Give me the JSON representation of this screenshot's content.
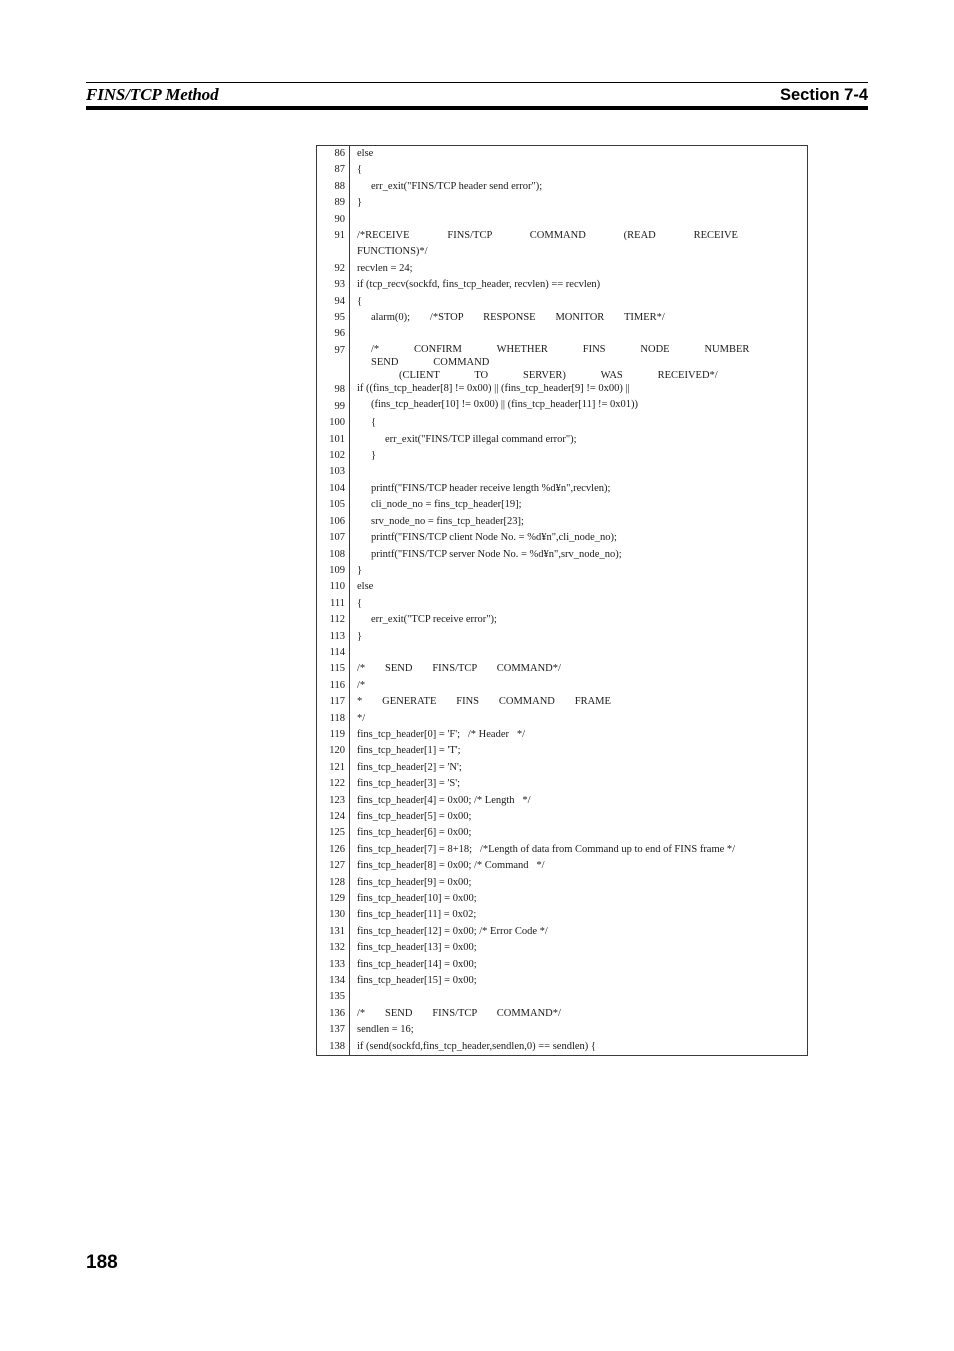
{
  "header": {
    "title": "FINS/TCP Method",
    "section": "Section 7-4"
  },
  "folio": {
    "page_number": "188"
  },
  "colors": {
    "text": "#000000",
    "rule": "#3a3a3a",
    "background": "#ffffff"
  },
  "listing": {
    "lines": [
      {
        "n": "86",
        "indent": 1,
        "text": "else"
      },
      {
        "n": "87",
        "indent": 1,
        "text": "{"
      },
      {
        "n": "88",
        "indent": 2,
        "text": "err_exit(\"FINS/TCP header send error\");"
      },
      {
        "n": "89",
        "indent": 1,
        "text": "}"
      },
      {
        "n": "90",
        "indent": 1,
        "text": ""
      },
      {
        "n": "91",
        "indent": 1,
        "text": "/*RECEIVE   FINS/TCP   COMMAND   (READ   RECEIVE   FUNCTIONS)*/",
        "style": "spaced"
      },
      {
        "n": "92",
        "indent": 1,
        "text": "recvlen = 24;"
      },
      {
        "n": "93",
        "indent": 1,
        "text": "if (tcp_recv(sockfd, fins_tcp_header, recvlen) == recvlen)"
      },
      {
        "n": "94",
        "indent": 1,
        "text": "{"
      },
      {
        "n": "95",
        "indent": 2,
        "text": "alarm(0);   /*STOP   RESPONSE   MONITOR   TIMER*/",
        "style": "spaced3"
      },
      {
        "n": "96",
        "indent": 1,
        "text": ""
      },
      {
        "n": "97",
        "indent": 2,
        "text_a": "/*   CONFIRM   WHETHER   FINS   NODE   NUMBER   SEND   COMMAND",
        "text_b": "(CLIENT   TO   SERVER)   WAS   RECEIVED*/",
        "kind": "split"
      },
      {
        "n": "98",
        "indent": 1,
        "text": "if ((fins_tcp_header[8] != 0x00) || (fins_tcp_header[9] != 0x00) ||",
        "kind": "overlap-a"
      },
      {
        "n": "99",
        "indent": 2,
        "text": "(fins_tcp_header[10] != 0x00) || (fins_tcp_header[11] != 0x01))",
        "kind": "overlap-b"
      },
      {
        "n": "100",
        "indent": 2,
        "text": "{"
      },
      {
        "n": "101",
        "indent": 3,
        "text": "err_exit(\"FINS/TCP illegal command error\");"
      },
      {
        "n": "102",
        "indent": 2,
        "text": "}"
      },
      {
        "n": "103",
        "indent": 1,
        "text": ""
      },
      {
        "n": "104",
        "indent": 2,
        "text": "printf(\"FINS/TCP header receive length %d¥n\",recvlen);"
      },
      {
        "n": "105",
        "indent": 2,
        "text": "cli_node_no = fins_tcp_header[19];"
      },
      {
        "n": "106",
        "indent": 2,
        "text": "srv_node_no = fins_tcp_header[23];"
      },
      {
        "n": "107",
        "indent": 2,
        "text": "printf(\"FINS/TCP client Node No. = %d¥n\",cli_node_no);"
      },
      {
        "n": "108",
        "indent": 2,
        "text": "printf(\"FINS/TCP server Node No. = %d¥n\",srv_node_no);"
      },
      {
        "n": "109",
        "indent": 1,
        "text": "}"
      },
      {
        "n": "110",
        "indent": 1,
        "text": "else"
      },
      {
        "n": "111",
        "indent": 1,
        "text": "{"
      },
      {
        "n": "112",
        "indent": 2,
        "text": "err_exit(\"TCP receive error\");"
      },
      {
        "n": "113",
        "indent": 1,
        "text": "}"
      },
      {
        "n": "114",
        "indent": 1,
        "text": ""
      },
      {
        "n": "115",
        "indent": 1,
        "text": "/*   SEND   FINS/TCP   COMMAND*/",
        "style": "spaced3"
      },
      {
        "n": "116",
        "indent": 1,
        "text": "/*"
      },
      {
        "n": "117",
        "indent": 1,
        "text": "*   GENERATE   FINS   COMMAND   FRAME",
        "style": "spaced3"
      },
      {
        "n": "118",
        "indent": 1,
        "text": "*/"
      },
      {
        "n": "119",
        "indent": 1,
        "text": "fins_tcp_header[0] = 'F';   /* Header   */"
      },
      {
        "n": "120",
        "indent": 1,
        "text": "fins_tcp_header[1] = 'T';"
      },
      {
        "n": "121",
        "indent": 1,
        "text": "fins_tcp_header[2] = 'N';"
      },
      {
        "n": "122",
        "indent": 1,
        "text": "fins_tcp_header[3] = 'S';"
      },
      {
        "n": "123",
        "indent": 1,
        "text": "fins_tcp_header[4] = 0x00; /* Length   */"
      },
      {
        "n": "124",
        "indent": 1,
        "text": "fins_tcp_header[5] = 0x00;"
      },
      {
        "n": "125",
        "indent": 1,
        "text": "fins_tcp_header[6] = 0x00;"
      },
      {
        "n": "126",
        "indent": 1,
        "text": "fins_tcp_header[7] = 8+18;   /*Length of data from Command up to end of FINS frame */"
      },
      {
        "n": "127",
        "indent": 1,
        "text": "fins_tcp_header[8] = 0x00; /* Command   */"
      },
      {
        "n": "128",
        "indent": 1,
        "text": "fins_tcp_header[9] = 0x00;"
      },
      {
        "n": "129",
        "indent": 1,
        "text": "fins_tcp_header[10] = 0x00;"
      },
      {
        "n": "130",
        "indent": 1,
        "text": "fins_tcp_header[11] = 0x02;"
      },
      {
        "n": "131",
        "indent": 1,
        "text": "fins_tcp_header[12] = 0x00; /* Error Code */"
      },
      {
        "n": "132",
        "indent": 1,
        "text": "fins_tcp_header[13] = 0x00;"
      },
      {
        "n": "133",
        "indent": 1,
        "text": "fins_tcp_header[14] = 0x00;"
      },
      {
        "n": "134",
        "indent": 1,
        "text": "fins_tcp_header[15] = 0x00;"
      },
      {
        "n": "135",
        "indent": 1,
        "text": ""
      },
      {
        "n": "136",
        "indent": 1,
        "text": "/*   SEND   FINS/TCP   COMMAND*/",
        "style": "spaced3"
      },
      {
        "n": "137",
        "indent": 1,
        "text": "sendlen = 16;"
      },
      {
        "n": "138",
        "indent": 1,
        "text": "if (send(sockfd,fins_tcp_header,sendlen,0) == sendlen) {"
      }
    ]
  }
}
